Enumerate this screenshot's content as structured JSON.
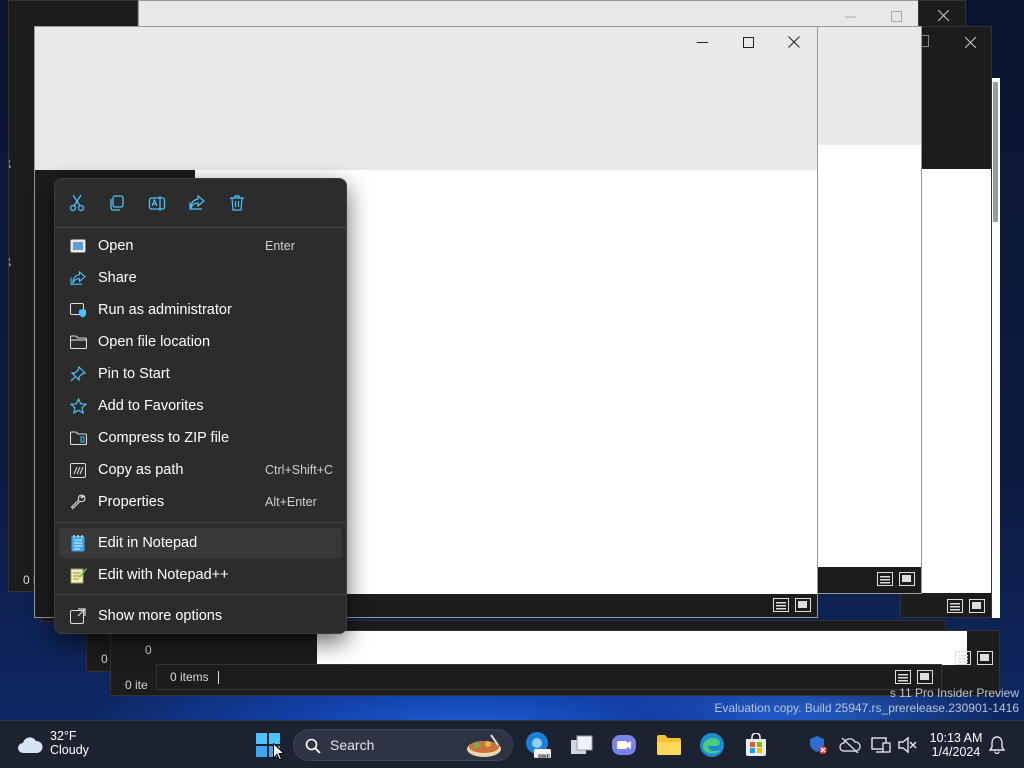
{
  "context_menu": {
    "toolbar": [
      {
        "icon": "cut-icon"
      },
      {
        "icon": "copy-icon"
      },
      {
        "icon": "rename-icon"
      },
      {
        "icon": "share-icon"
      },
      {
        "icon": "delete-icon"
      }
    ],
    "items": [
      {
        "label": "Open",
        "accelerator": "Enter",
        "icon": "open-icon"
      },
      {
        "label": "Share",
        "accelerator": "",
        "icon": "share-icon"
      },
      {
        "label": "Run as administrator",
        "accelerator": "",
        "icon": "shield-icon"
      },
      {
        "label": "Open file location",
        "accelerator": "",
        "icon": "folder-icon"
      },
      {
        "label": "Pin to Start",
        "accelerator": "",
        "icon": "pin-icon"
      },
      {
        "label": "Add to Favorites",
        "accelerator": "",
        "icon": "star-icon"
      },
      {
        "label": "Compress to ZIP file",
        "accelerator": "",
        "icon": "zip-icon"
      },
      {
        "label": "Copy as path",
        "accelerator": "Ctrl+Shift+C",
        "icon": "copy-path-icon"
      },
      {
        "label": "Properties",
        "accelerator": "Alt+Enter",
        "icon": "wrench-icon"
      },
      {
        "label": "Edit in Notepad",
        "accelerator": "",
        "icon": "notepad-icon"
      },
      {
        "label": "Edit with Notepad++",
        "accelerator": "",
        "icon": "notepadpp-icon"
      },
      {
        "label": "Show more options",
        "accelerator": "",
        "icon": "more-options-icon"
      }
    ]
  },
  "windows": {
    "status_items": "0 items",
    "status_fragments": [
      "0 i",
      "0",
      "0 i",
      "0",
      "0 ite"
    ],
    "side_fragments": [
      "R",
      "R"
    ]
  },
  "taskbar": {
    "weather_temp": "32°F",
    "weather_desc": "Cloudy",
    "search_placeholder": "Search",
    "clock_time": "10:13 AM",
    "clock_date": "1/4/2024",
    "edge_badge": "PRE"
  },
  "watermark": {
    "line1": "s 11 Pro Insider Preview",
    "line2": "Evaluation copy. Build 25947.rs_prerelease.230901-1416"
  },
  "colors": {
    "menu_bg": "#2c2c2c",
    "accent": "#4cc2ff",
    "taskbar_bg": "#1d2230"
  }
}
